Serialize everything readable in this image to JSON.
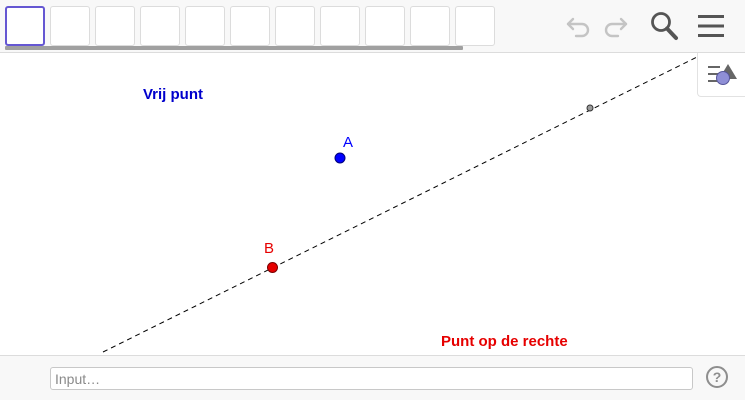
{
  "toolbar": {
    "tools": [
      {
        "name": "tool-move",
        "active": true
      },
      {
        "name": "tool-1",
        "active": false
      },
      {
        "name": "tool-2",
        "active": false
      },
      {
        "name": "tool-3",
        "active": false
      },
      {
        "name": "tool-4",
        "active": false
      },
      {
        "name": "tool-5",
        "active": false
      },
      {
        "name": "tool-6",
        "active": false
      },
      {
        "name": "tool-7",
        "active": false
      },
      {
        "name": "tool-8",
        "active": false
      },
      {
        "name": "tool-9",
        "active": false
      },
      {
        "name": "tool-10",
        "active": false
      }
    ],
    "icons": {
      "undo": "undo-icon",
      "redo": "redo-icon",
      "search": "search-icon",
      "menu": "menu-icon"
    },
    "active_color": "#6557d2"
  },
  "graphics": {
    "free_point_caption": "Vrij punt",
    "free_point_caption_color": "#0000cc",
    "line_point_caption": "Punt op de rechte",
    "line_point_caption_color": "#e60000",
    "point_a": {
      "label": "A",
      "color": "#0000ff"
    },
    "point_b": {
      "label": "B",
      "color": "#e60000"
    },
    "line": {
      "style": "dashed",
      "color": "#000000"
    }
  },
  "style_bar": {
    "icon": "style-bar-icon"
  },
  "input_bar": {
    "placeholder": "Input…",
    "help_icon": "help-icon",
    "help_text": "?"
  }
}
